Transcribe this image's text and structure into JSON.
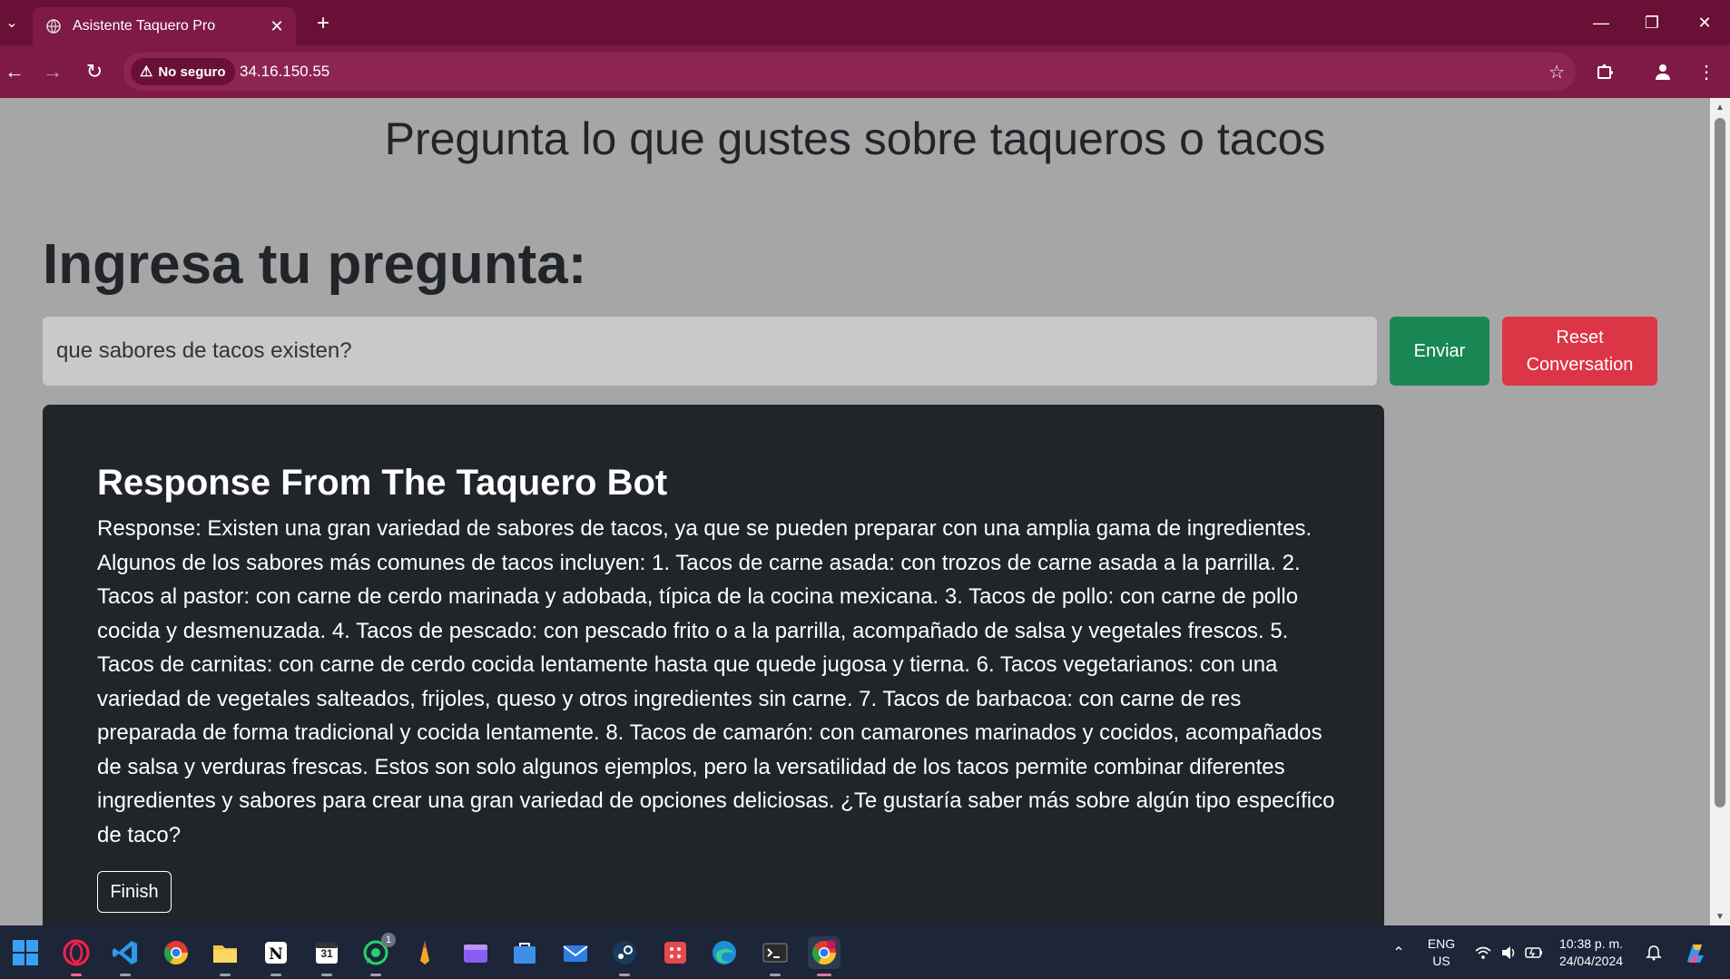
{
  "browser": {
    "tab_title": "Asistente Taquero Pro",
    "security_label": "No seguro",
    "url": "34.16.150.55",
    "colors": {
      "frame": "#6a0f35",
      "toolbar": "#7f1a46"
    }
  },
  "page": {
    "heading": "Pregunta lo que gustes sobre taqueros o tacos",
    "ask_title": "Ingresa tu pregunta:",
    "question_value": "que sabores de tacos existen?",
    "send_label": "Enviar",
    "reset_label": "Reset Conversation",
    "response": {
      "title": "Response From The Taquero Bot",
      "text": "Response: Existen una gran variedad de sabores de tacos, ya que se pueden preparar con una amplia gama de ingredientes. Algunos de los sabores más comunes de tacos incluyen: 1. Tacos de carne asada: con trozos de carne asada a la parrilla. 2. Tacos al pastor: con carne de cerdo marinada y adobada, típica de la cocina mexicana. 3. Tacos de pollo: con carne de pollo cocida y desmenuzada. 4. Tacos de pescado: con pescado frito o a la parrilla, acompañado de salsa y vegetales frescos. 5. Tacos de carnitas: con carne de cerdo cocida lentamente hasta que quede jugosa y tierna. 6. Tacos vegetarianos: con una variedad de vegetales salteados, frijoles, queso y otros ingredientes sin carne. 7. Tacos de barbacoa: con carne de res preparada de forma tradicional y cocida lentamente. 8. Tacos de camarón: con camarones marinados y cocidos, acompañados de salsa y verduras frescas. Estos son solo algunos ejemplos, pero la versatilidad de los tacos permite combinar diferentes ingredientes y sabores para crear una gran variedad de opciones deliciosas. ¿Te gustaría saber más sobre algún tipo específico de taco?",
      "finish_label": "Finish"
    },
    "colors": {
      "send": "#198754",
      "reset": "#dc3545",
      "card": "#212529"
    }
  },
  "taskbar": {
    "whatsapp_badge": "1",
    "calendar_day": "31",
    "lang_line1": "ENG",
    "lang_line2": "US",
    "time": "10:38 p. m.",
    "date": "24/04/2024"
  }
}
